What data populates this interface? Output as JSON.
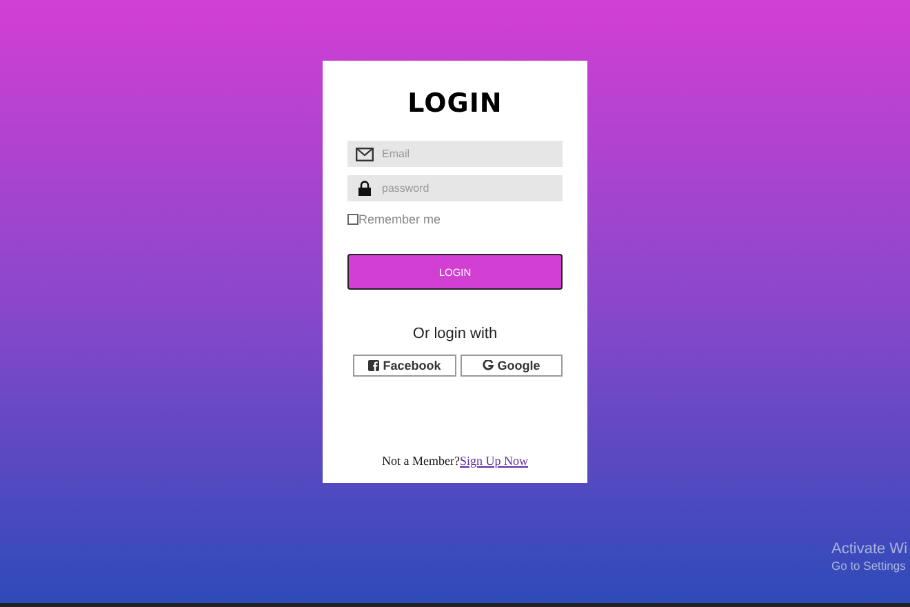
{
  "login_card": {
    "title": "LOGIN",
    "fields": [
      {
        "kind": "email",
        "placeholder": "Email"
      },
      {
        "kind": "password",
        "placeholder": "password"
      }
    ],
    "remember": {
      "label": "Remember me",
      "checked": false
    },
    "submit": "LOGIN",
    "alt_heading": "Or login with",
    "social_buttons": [
      {
        "kind": "facebook",
        "label": "Facebook"
      },
      {
        "kind": "google",
        "label": "Google"
      }
    ],
    "footer": {
      "text": "Not a Member?",
      "link": "Sign Up Now"
    }
  },
  "os_notice": {
    "title": "Activate Wi",
    "subtitle": "Go to Settings"
  }
}
